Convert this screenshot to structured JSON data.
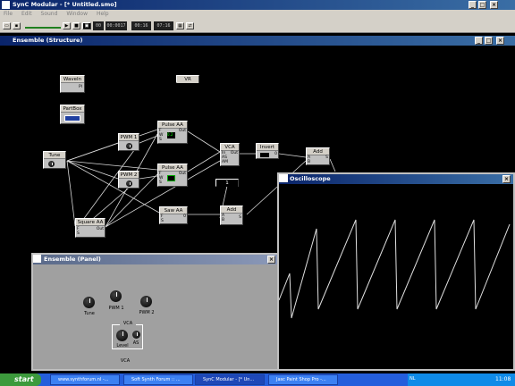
{
  "app": {
    "title": "SynC Modular - [* Untitled.smo]",
    "menu": [
      "File",
      "Edit",
      "Sound",
      "Window",
      "Help"
    ],
    "toolbar_lcds": [
      "00",
      "00:0017",
      "00:16",
      "07:16"
    ]
  },
  "structure_window": {
    "title": "Ensemble (Structure)"
  },
  "modules": {
    "wavein": {
      "label": "WaveIn",
      "port": "Pl"
    },
    "vr": {
      "label": "VR"
    },
    "partbox": {
      "label": "PartBox"
    },
    "pulse_a1": {
      "label": "Pulse AA",
      "ports": [
        "F",
        "W",
        "S"
      ],
      "out": "Out",
      "value": "0.2"
    },
    "pulse_a2": {
      "label": "Pulse AA",
      "ports": [
        "F",
        "W",
        "S"
      ],
      "out": "Out"
    },
    "pwm1": {
      "label": "PWM 1"
    },
    "pwm2": {
      "label": "PWM 2"
    },
    "tune": {
      "label": "Tune"
    },
    "vca": {
      "label": "VCA",
      "ports": [
        "In",
        "AS",
        "AM"
      ],
      "out": "Out"
    },
    "invert": {
      "label": "Invert",
      "value": "0"
    },
    "add1": {
      "label": "Add",
      "ports": [
        "A",
        "B"
      ],
      "out": "S"
    },
    "square": {
      "label": "Square AA",
      "ports": [
        "F",
        "S"
      ],
      "out": "Out"
    },
    "saw": {
      "label": "Saw AA",
      "ports": [
        "F",
        "S"
      ],
      "out": "0"
    },
    "add2": {
      "label": "Add",
      "ports": [
        "A",
        "B"
      ],
      "out": "S"
    },
    "const1": {
      "label": "1"
    }
  },
  "oscilloscope": {
    "title": "Oscilloscope"
  },
  "panel": {
    "title": "Ensemble (Panel)",
    "knobs": [
      "Tune",
      "PWM 1",
      "PWM 2"
    ],
    "group_label": "VCA",
    "group_knobs": [
      "Level",
      "AS"
    ],
    "bottom_label": "VCA"
  },
  "taskbar": {
    "start": "start",
    "tasks": [
      "www.synthforum.nl -...",
      "Soft Synth Forum :: ...",
      "SynC Modular - [* Un...",
      "Jasc Paint Shop Pro -..."
    ],
    "lang": "NL",
    "clock": "11:08"
  }
}
